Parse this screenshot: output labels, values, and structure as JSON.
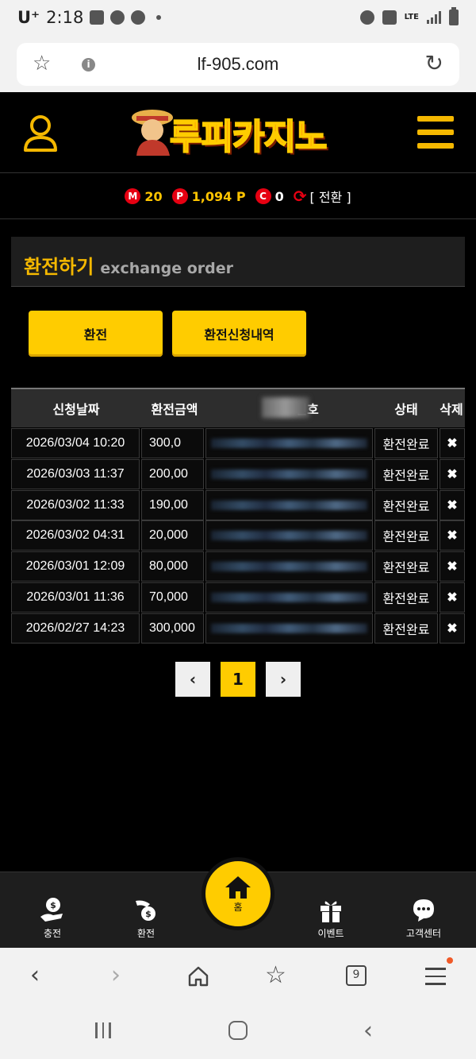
{
  "status_bar": {
    "carrier": "U⁺",
    "time": "2:18",
    "network": "LTE"
  },
  "browser": {
    "url": "lf-905.com",
    "tab_count": "9"
  },
  "header": {
    "logo_text": "루피카지노"
  },
  "points": {
    "m_badge": "M",
    "m_value": "20",
    "p_badge": "P",
    "p_value": "1,094 P",
    "c_badge": "C",
    "c_value": "0",
    "switch_label": "[ 전환 ]"
  },
  "section": {
    "title_ko": "환전하기",
    "title_en": "exchange order"
  },
  "tabs": [
    {
      "label": "환전"
    },
    {
      "label": "환전신청내역"
    }
  ],
  "table": {
    "headers": [
      "신청날짜",
      "환전금액",
      "번호",
      "상태",
      "삭제"
    ],
    "rows": [
      {
        "date": "2026/03/04 10:20",
        "amount": "300,0",
        "status": "환전완료",
        "delete": "✖"
      },
      {
        "date": "2026/03/03 11:37",
        "amount": "200,00",
        "status": "환전완료",
        "delete": "✖"
      },
      {
        "date": "2026/03/02 11:33",
        "amount": "190,00",
        "status": "환전완료",
        "delete": "✖"
      },
      {
        "date": "2026/03/02 04:31",
        "amount": "20,000",
        "status": "환전완료",
        "delete": "✖"
      },
      {
        "date": "2026/03/01 12:09",
        "amount": "80,000",
        "status": "환전완료",
        "delete": "✖"
      },
      {
        "date": "2026/03/01 11:36",
        "amount": "70,000",
        "status": "환전완료",
        "delete": "✖"
      },
      {
        "date": "2026/02/27 14:23",
        "amount": "300,000",
        "status": "환전완료",
        "delete": "✖"
      }
    ]
  },
  "pagination": {
    "prev": "‹",
    "current": "1",
    "next": "›"
  },
  "bottom_nav": [
    {
      "label": "충전"
    },
    {
      "label": "환전"
    },
    {
      "label": "홈"
    },
    {
      "label": "이벤트"
    },
    {
      "label": "고객센터"
    }
  ]
}
